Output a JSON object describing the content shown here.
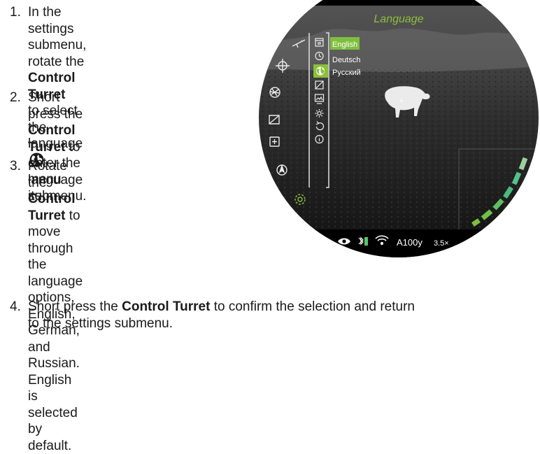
{
  "steps": [
    {
      "num": "1.",
      "lines": [
        {
          "pre": "In the settings submenu,"
        },
        {
          "pre": "rotate the ",
          "bold": "Control Turret"
        },
        {
          "pre": "to select the language",
          "icon": "globe-icon"
        },
        {
          "pre": "menu item."
        }
      ]
    },
    {
      "num": "2.",
      "lines": [
        {
          "pre": "Short press the ",
          "bold": "Control"
        },
        {
          "bold": "Turret",
          "post": " to enter the"
        },
        {
          "pre": "language submenu."
        }
      ]
    },
    {
      "num": "3.",
      "lines": [
        {
          "pre": "Rotate the ",
          "bold": "Control"
        },
        {
          "bold": "Turret",
          "post": " to move through"
        },
        {
          "pre": "the language options,"
        },
        {
          "pre": "English, German, and"
        },
        {
          "pre": "Russian. English is"
        },
        {
          "pre": "selected by default."
        }
      ]
    },
    {
      "num": "4.",
      "lines": [
        {
          "pre": "Short press the ",
          "bold": "Control Turret",
          "post": " to confirm the selection and return"
        },
        {
          "pre": "to the settings submenu."
        }
      ]
    }
  ],
  "scope": {
    "menu_title": "Language",
    "languages": [
      "English",
      "Deutsch",
      "Русский"
    ],
    "selected_language": "English",
    "status_bar": {
      "range": "A100y",
      "zoom": "3.5×"
    },
    "icons": {
      "left_column": [
        "rifle-icon",
        "crosshair-icon",
        "aperture-icon",
        "display-icon",
        "add-icon",
        "compass-icon",
        "gear-icon"
      ],
      "submenu_column": [
        "calendar-icon",
        "clock-icon",
        "globe-icon",
        "contrast-icon",
        "picture-icon",
        "sun-icon",
        "reset-icon",
        "info-icon"
      ],
      "status": [
        "eye-icon",
        "bluetooth-battery-icon",
        "wifi-icon"
      ]
    },
    "colors": {
      "accent": "#7fbf3f",
      "title": "#9acd32",
      "meter": "#55c28a"
    }
  }
}
